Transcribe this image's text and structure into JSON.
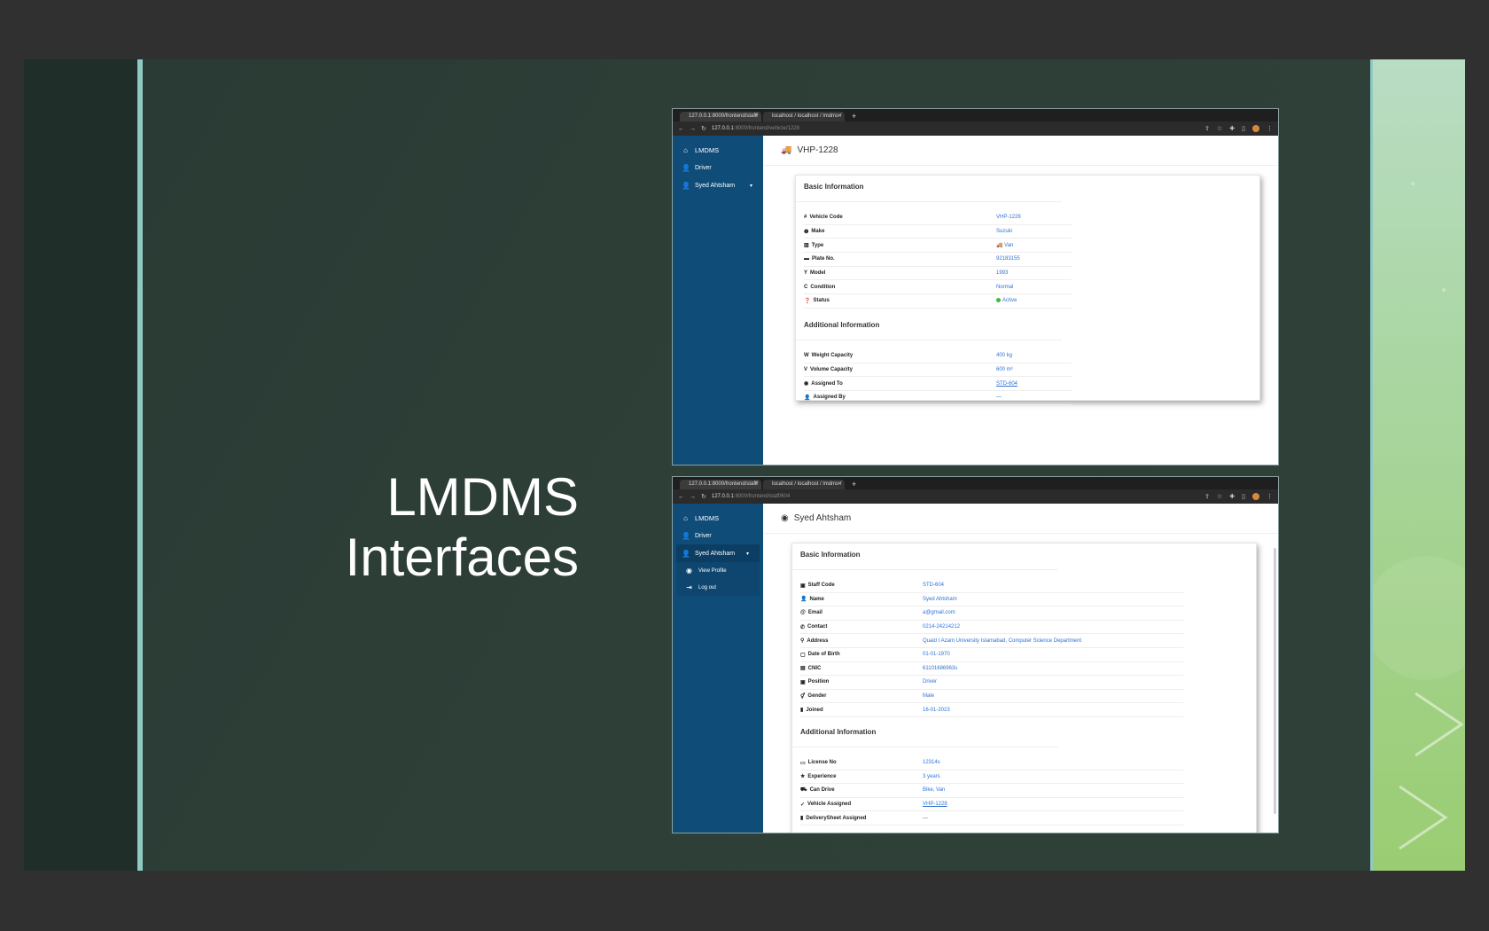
{
  "slide": {
    "title_line1": "LMDMS",
    "title_line2": "Interfaces",
    "colors": {
      "background": "#2d3f37",
      "accent": "#8fc9c2",
      "right_panel": "#a9d6a0"
    }
  },
  "screens": [
    {
      "tabs": [
        {
          "label": "127.0.0.1:8000/frontend/staff/",
          "close": "×"
        },
        {
          "label": "localhost / localhost / lmdms /",
          "close": "×"
        }
      ],
      "new_tab": "+",
      "url_host": "127.0.0.1",
      "url_path": ":8000/frontend/vehicle/1228",
      "sidebar": {
        "brand": "LMDMS",
        "items": [
          {
            "label": "Driver",
            "icon": "user-icon"
          }
        ],
        "user": {
          "label": "Syed Ahtsham",
          "icon": "user-icon",
          "caret": "▾"
        }
      },
      "page_title": "VHP-1228",
      "page_icon": "truck-icon",
      "sections": [
        {
          "title": "Basic Information",
          "rows": [
            {
              "icon": "#",
              "label": "Vehicle Code",
              "value": "VHP-1228"
            },
            {
              "icon": "❶",
              "label": "Make",
              "value": "Suzuki"
            },
            {
              "icon": "▥",
              "label": "Type",
              "value": "Van",
              "value_icon": "🚚"
            },
            {
              "icon": "▬",
              "label": "Plate No.",
              "value": "92183155"
            },
            {
              "icon": "Y",
              "label": "Model",
              "value": "1993"
            },
            {
              "icon": "C",
              "label": "Condition",
              "value": "Normal"
            },
            {
              "icon": "❓",
              "label": "Status",
              "value": "Active",
              "status": true
            }
          ]
        },
        {
          "title": "Additional Information",
          "rows": [
            {
              "icon": "W",
              "label": "Weight Capacity",
              "value": "400 kg"
            },
            {
              "icon": "V",
              "label": "Volume Capacity",
              "value": "600 m³"
            },
            {
              "icon": "◉",
              "label": "Assigned To",
              "value": "STD-604",
              "link": true
            },
            {
              "icon": "👤",
              "label": "Assigned By",
              "value": "—"
            }
          ]
        }
      ]
    },
    {
      "tabs": [
        {
          "label": "127.0.0.1:8000/frontend/staff/",
          "close": "×"
        },
        {
          "label": "localhost / localhost / lmdms /",
          "close": "×"
        }
      ],
      "new_tab": "+",
      "url_host": "127.0.0.1",
      "url_path": ":8000/frontend/staff/604",
      "sidebar": {
        "brand": "LMDMS",
        "items": [
          {
            "label": "Driver",
            "icon": "user-icon"
          }
        ],
        "user": {
          "label": "Syed Ahtsham",
          "icon": "user-icon",
          "caret": "▾"
        },
        "submenu": [
          {
            "label": "View Profile",
            "icon": "eye-icon"
          },
          {
            "label": "Log out",
            "icon": "logout-icon"
          }
        ]
      },
      "page_title": "Syed Ahtsham",
      "page_icon": "user-circle-icon",
      "sections": [
        {
          "title": "Basic Information",
          "rows": [
            {
              "icon": "▣",
              "label": "Staff Code",
              "value": "STD-604"
            },
            {
              "icon": "👤",
              "label": "Name",
              "value": "Syed Ahtsham"
            },
            {
              "icon": "@",
              "label": "Email",
              "value": "a@gmail.com"
            },
            {
              "icon": "✆",
              "label": "Contact",
              "value": "0214-24214212"
            },
            {
              "icon": "⚲",
              "label": "Address",
              "value": "Quaid I Azam University Islamabad, Computer Science Department"
            },
            {
              "icon": "▢",
              "label": "Date of Birth",
              "value": "01-01-1970"
            },
            {
              "icon": "▤",
              "label": "CNIC",
              "value": "61101686963s"
            },
            {
              "icon": "▣",
              "label": "Position",
              "value": "Driver"
            },
            {
              "icon": "⚥",
              "label": "Gender",
              "value": "Male"
            },
            {
              "icon": "▮",
              "label": "Joined",
              "value": "16-01-2023"
            }
          ]
        },
        {
          "title": "Additional Information",
          "rows": [
            {
              "icon": "▭",
              "label": "License No",
              "value": "12314s"
            },
            {
              "icon": "★",
              "label": "Experience",
              "value": "3 years"
            },
            {
              "icon": "⛟",
              "label": "Can Drive",
              "value": "Bike, Van"
            },
            {
              "icon": "✓",
              "label": "Vehicle Assigned",
              "value": "VHP-1228",
              "link": true
            },
            {
              "icon": "▮",
              "label": "DeliverySheet Assigned",
              "value": "—"
            }
          ]
        }
      ]
    }
  ]
}
